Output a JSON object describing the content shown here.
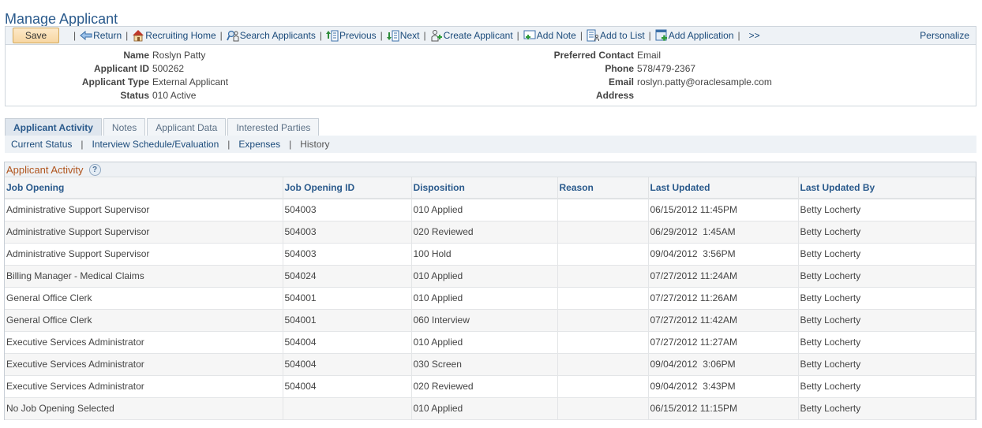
{
  "page": {
    "title": "Manage Applicant"
  },
  "toolbar": {
    "save_label": "Save",
    "items": [
      {
        "label": "Return",
        "icon": "arrow-left-icon"
      },
      {
        "label": "Recruiting Home",
        "icon": "home-icon"
      },
      {
        "label": "Search Applicants",
        "icon": "search-applicants-icon"
      },
      {
        "label": "Previous",
        "icon": "previous-icon"
      },
      {
        "label": "Next",
        "icon": "next-icon"
      },
      {
        "label": "Create Applicant",
        "icon": "create-applicant-icon"
      },
      {
        "label": "Add Note",
        "icon": "add-note-icon"
      },
      {
        "label": "Add to List",
        "icon": "add-to-list-icon"
      },
      {
        "label": "Add Application",
        "icon": "add-application-icon"
      }
    ],
    "more_label": ">>",
    "personalize_label": "Personalize"
  },
  "applicant": {
    "left": [
      {
        "label": "Name",
        "value": "Roslyn Patty"
      },
      {
        "label": "Applicant ID",
        "value": "500262"
      },
      {
        "label": "Applicant Type",
        "value": "External Applicant"
      },
      {
        "label": "Status",
        "value": "010 Active"
      }
    ],
    "right": [
      {
        "label": "Preferred Contact",
        "value": "Email"
      },
      {
        "label": "Phone",
        "value": "578/479-2367"
      },
      {
        "label": "Email",
        "value": "roslyn.patty@oraclesample.com"
      },
      {
        "label": "Address",
        "value": ""
      }
    ]
  },
  "tabs": [
    {
      "label": "Applicant Activity",
      "active": true
    },
    {
      "label": "Notes",
      "active": false
    },
    {
      "label": "Applicant Data",
      "active": false
    },
    {
      "label": "Interested Parties",
      "active": false
    }
  ],
  "subnav": [
    {
      "label": "Current Status",
      "link": true
    },
    {
      "label": "Interview Schedule/Evaluation",
      "link": true
    },
    {
      "label": "Expenses",
      "link": true
    },
    {
      "label": "History",
      "link": false
    }
  ],
  "grid": {
    "title": "Applicant Activity",
    "columns": [
      "Job Opening",
      "Job Opening ID",
      "Disposition",
      "Reason",
      "Last Updated",
      "Last Updated By"
    ],
    "rows": [
      [
        "Administrative Support Supervisor",
        "504003",
        "010 Applied",
        "",
        "06/15/2012 11:45PM",
        "Betty Locherty"
      ],
      [
        "Administrative Support Supervisor",
        "504003",
        "020 Reviewed",
        "",
        "06/29/2012  1:45AM",
        "Betty Locherty"
      ],
      [
        "Administrative Support Supervisor",
        "504003",
        "100 Hold",
        "",
        "09/04/2012  3:56PM",
        "Betty Locherty"
      ],
      [
        "Billing Manager - Medical Claims",
        "504024",
        "010 Applied",
        "",
        "07/27/2012 11:24AM",
        "Betty Locherty"
      ],
      [
        "General Office Clerk",
        "504001",
        "010 Applied",
        "",
        "07/27/2012 11:26AM",
        "Betty Locherty"
      ],
      [
        "General Office Clerk",
        "504001",
        "060 Interview",
        "",
        "07/27/2012 11:42AM",
        "Betty Locherty"
      ],
      [
        "Executive Services Administrator",
        "504004",
        "010 Applied",
        "",
        "07/27/2012 11:27AM",
        "Betty Locherty"
      ],
      [
        "Executive Services Administrator",
        "504004",
        "030 Screen",
        "",
        "09/04/2012  3:06PM",
        "Betty Locherty"
      ],
      [
        "Executive Services Administrator",
        "504004",
        "020 Reviewed",
        "",
        "09/04/2012  3:43PM",
        "Betty Locherty"
      ],
      [
        "No Job Opening Selected",
        "",
        "010 Applied",
        "",
        "06/15/2012 11:15PM",
        "Betty Locherty"
      ]
    ]
  },
  "colors": {
    "title": "#2a5a8c",
    "link": "#1a4a7a",
    "grid_title": "#b0551e"
  }
}
